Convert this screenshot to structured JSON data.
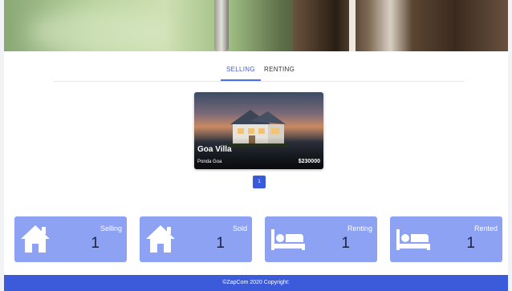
{
  "tabs": [
    {
      "label": "SELLING",
      "active": true
    },
    {
      "label": "RENTING",
      "active": false
    }
  ],
  "listing": {
    "title": "Goa Villa",
    "location": "Ponda Goa",
    "price": "$230000"
  },
  "pagination": {
    "current_page": "1"
  },
  "stats": [
    {
      "label": "Selling",
      "value": "1",
      "icon": "home-icon"
    },
    {
      "label": "Sold",
      "value": "1",
      "icon": "home-icon"
    },
    {
      "label": "Renting",
      "value": "1",
      "icon": "bed-icon"
    },
    {
      "label": "Rented",
      "value": "1",
      "icon": "bed-icon"
    }
  ],
  "footer": {
    "text": "©ZapCom 2020 Copyright:"
  },
  "colors": {
    "primary": "#3b5bdb",
    "stat_card": "#8da2f3",
    "stat_value": "#1c2240",
    "active_tab": "#4a5bc4"
  }
}
